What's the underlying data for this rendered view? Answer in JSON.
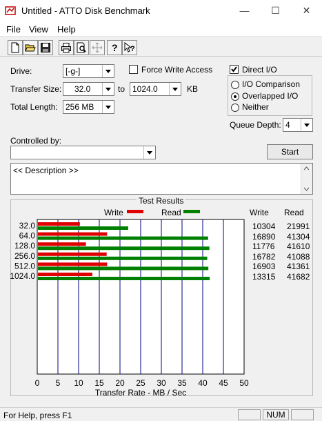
{
  "window": {
    "title": "Untitled - ATTO Disk Benchmark",
    "icons": {
      "app": "atto-app-icon",
      "minimize": "minimize-icon",
      "maximize": "maximize-icon",
      "close": "close-icon"
    }
  },
  "menu": {
    "items": [
      "File",
      "View",
      "Help"
    ]
  },
  "toolbar": {
    "icons": [
      "new-document-icon",
      "open-folder-icon",
      "save-icon",
      "print-icon",
      "print-preview-icon",
      "move-icon",
      "help-icon",
      "context-help-icon"
    ]
  },
  "form": {
    "drive_label": "Drive:",
    "drive_value": "[-g-]",
    "force_write_access_label": "Force Write Access",
    "force_write_access_checked": false,
    "direct_io_label": "Direct I/O",
    "direct_io_checked": true,
    "transfer_size_label": "Transfer Size:",
    "transfer_size_from": "32.0",
    "to_label": "to",
    "transfer_size_to": "1024.0",
    "kb_label": "KB",
    "total_length_label": "Total Length:",
    "total_length_value": "256 MB",
    "io_options": [
      {
        "label": "I/O Comparison",
        "selected": false
      },
      {
        "label": "Overlapped I/O",
        "selected": true
      },
      {
        "label": "Neither",
        "selected": false
      }
    ],
    "queue_depth_label": "Queue Depth:",
    "queue_depth_value": "4",
    "controlled_by_label": "Controlled by:",
    "controlled_by_value": "",
    "start_label": "Start",
    "description": "<< Description >>"
  },
  "results": {
    "title": "Test Results",
    "write_header": "Write",
    "read_header": "Read",
    "rows": [
      {
        "size": "32.0",
        "write": "10304",
        "read": "21991"
      },
      {
        "size": "64.0",
        "write": "16890",
        "read": "41304"
      },
      {
        "size": "128.0",
        "write": "11776",
        "read": "41610"
      },
      {
        "size": "256.0",
        "write": "16782",
        "read": "41088"
      },
      {
        "size": "512.0",
        "write": "16903",
        "read": "41361"
      },
      {
        "size": "1024.0",
        "write": "13315",
        "read": "41682"
      }
    ]
  },
  "chart_data": {
    "type": "bar",
    "orientation": "horizontal",
    "categories": [
      "32.0",
      "64.0",
      "128.0",
      "256.0",
      "512.0",
      "1024.0"
    ],
    "series": [
      {
        "name": "Write",
        "color": "#e00000",
        "values": [
          10.304,
          16.89,
          11.776,
          16.782,
          16.903,
          13.315
        ]
      },
      {
        "name": "Read",
        "color": "#008000",
        "values": [
          21.991,
          41.304,
          41.61,
          41.088,
          41.361,
          41.682
        ]
      }
    ],
    "xlabel": "Transfer Rate - MB / Sec",
    "xlim": [
      0,
      50
    ],
    "xticks": [
      "0",
      "5",
      "10",
      "15",
      "20",
      "25",
      "30",
      "35",
      "40",
      "45",
      "50"
    ],
    "grid": true,
    "legend_position": "top"
  },
  "status": {
    "text": "For Help, press F1",
    "num": "NUM"
  }
}
